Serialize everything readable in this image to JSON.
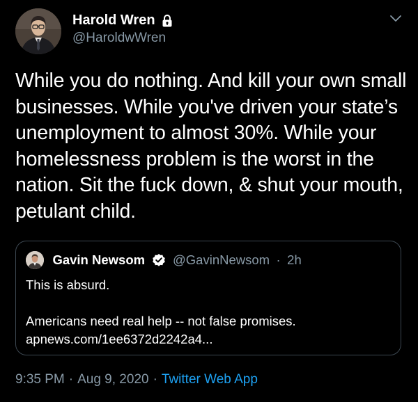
{
  "author": {
    "display_name": "Harold Wren",
    "handle": "@HaroldwWren",
    "avatar_icon": "avatar-photo",
    "protected_icon": "lock-icon"
  },
  "menu_icon": "chevron-down-icon",
  "tweet": {
    "text": "While you do nothing. And kill your own small businesses. While you've driven your state’s unemployment to almost 30%. While your homelessness problem is the worst in the nation. Sit the fuck down, & shut your mouth, petulant child."
  },
  "quoted_tweet": {
    "display_name": "Gavin Newsom",
    "verified_icon": "verified-badge-icon",
    "handle": "@GavinNewsom",
    "separator": "·",
    "time_ago": "2h",
    "line1": "This is absurd.",
    "line2": "Americans need real help -- not false promises.",
    "link": "apnews.com/1ee6372d2242a4..."
  },
  "footer": {
    "time": "9:35 PM",
    "separator": "·",
    "date": "Aug 9, 2020",
    "source": "Twitter Web App"
  },
  "colors": {
    "background": "#000000",
    "primary_text": "#ffffff",
    "secondary_text": "#8899a6",
    "link": "#1da1f2",
    "border": "#3d4852"
  }
}
